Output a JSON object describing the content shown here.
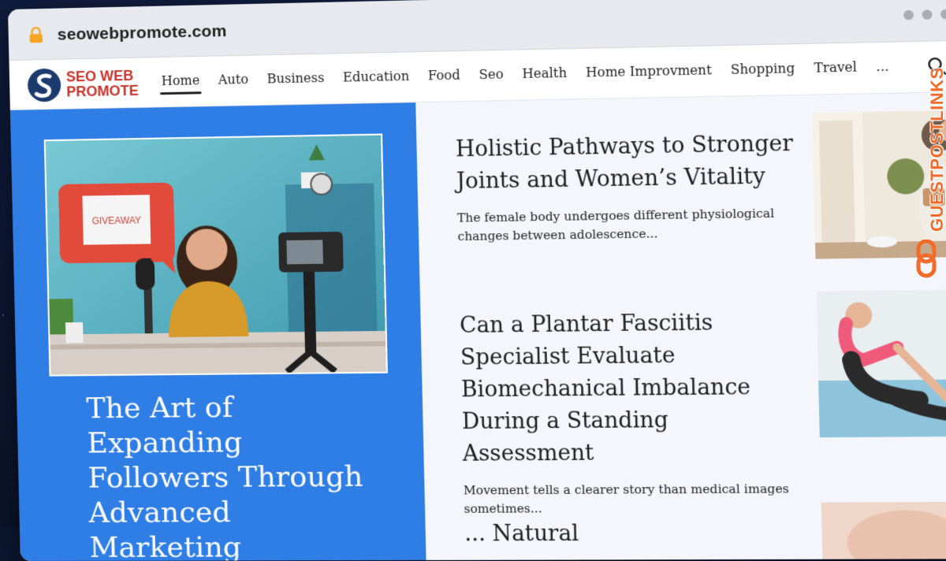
{
  "browser": {
    "url": "seowebpromote.com"
  },
  "site": {
    "logo_line1": "SEO WEB",
    "logo_line2": "PROMOTE",
    "nav": [
      {
        "label": "Home",
        "active": true
      },
      {
        "label": "Auto"
      },
      {
        "label": "Business"
      },
      {
        "label": "Education"
      },
      {
        "label": "Food"
      },
      {
        "label": "Seo"
      },
      {
        "label": "Health"
      },
      {
        "label": "Home Improvment"
      },
      {
        "label": "Shopping"
      },
      {
        "label": "Travel"
      },
      {
        "label": "..."
      }
    ]
  },
  "featured": {
    "image_sign": "GIVEAWAY",
    "title": "The Art of Expanding Followers Through Advanced Marketing"
  },
  "articles": [
    {
      "title": "Holistic Pathways to Stronger Joints and Women’s Vitality",
      "excerpt": "The female body undergoes different physiological changes between adolescence..."
    },
    {
      "title": "Can a Plantar Fasciitis Specialist Evaluate Biomechanical Imbalance During a Standing Assessment",
      "excerpt": "Movement tells a clearer story than medical images sometimes..."
    },
    {
      "title": "... Natural",
      "excerpt": ""
    }
  ],
  "watermark": "GUESTPOSTLINKS",
  "colors": {
    "featured_bg": "#2f7ee6",
    "brand_red": "#c8322b",
    "brand_navy": "#1c3a6e",
    "watermark": "#f36b2b"
  }
}
